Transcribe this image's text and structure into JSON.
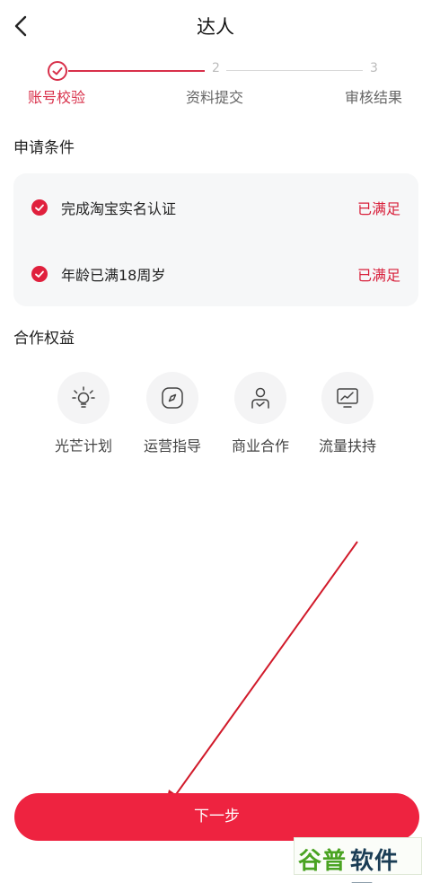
{
  "header": {
    "title": "达人"
  },
  "steps": [
    {
      "number": "",
      "label": "账号校验",
      "state": "done"
    },
    {
      "number": "2",
      "label": "资料提交",
      "state": "pending"
    },
    {
      "number": "3",
      "label": "审核结果",
      "state": "pending"
    }
  ],
  "conditions": {
    "title": "申请条件",
    "items": [
      {
        "text": "完成淘宝实名认证",
        "status": "已满足"
      },
      {
        "text": "年龄已满18周岁",
        "status": "已满足"
      }
    ]
  },
  "benefits": {
    "title": "合作权益",
    "items": [
      {
        "label": "光芒计划",
        "icon": "lightbulb-icon"
      },
      {
        "label": "运营指导",
        "icon": "compass-icon"
      },
      {
        "label": "商业合作",
        "icon": "person-handshake-icon"
      },
      {
        "label": "流量扶持",
        "icon": "trend-chart-icon"
      }
    ]
  },
  "next_button": {
    "label": "下一步"
  },
  "watermark": {
    "part1": "谷普",
    "part2": "软件园"
  },
  "colors": {
    "accent": "#d8304a",
    "button": "#ee2340",
    "card_bg": "#f6f7f8"
  }
}
